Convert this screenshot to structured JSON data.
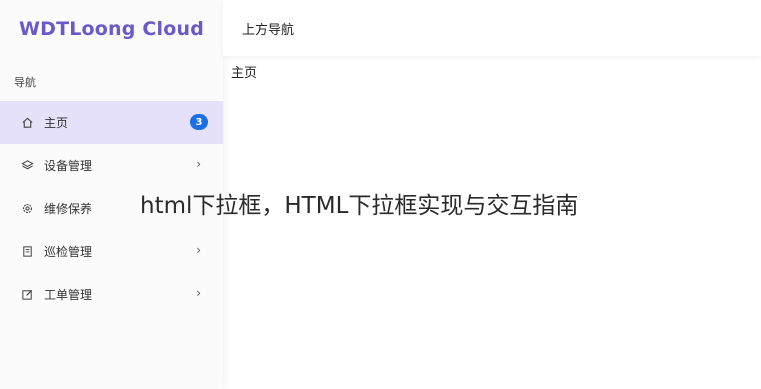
{
  "app": {
    "brand": "WDTLoong Cloud"
  },
  "sidebar": {
    "section_title": "导航",
    "items": [
      {
        "label": "主页",
        "icon": "home-icon",
        "badge": "3",
        "active": true
      },
      {
        "label": "设备管理",
        "icon": "layers-icon",
        "chevron": "›"
      },
      {
        "label": "维修保养",
        "icon": "gear-icon"
      },
      {
        "label": "巡检管理",
        "icon": "clipboard-icon",
        "chevron": "›"
      },
      {
        "label": "工单管理",
        "icon": "edit-icon",
        "chevron": "›"
      }
    ]
  },
  "header": {
    "title": "上方导航"
  },
  "main": {
    "title": "主页"
  },
  "overlay": {
    "text": "html下拉框，HTML下拉框实现与交互指南"
  },
  "colors": {
    "brand": "#6a5ac8",
    "active_bg": "#e5e1fb",
    "badge": "#1b6ee6"
  }
}
